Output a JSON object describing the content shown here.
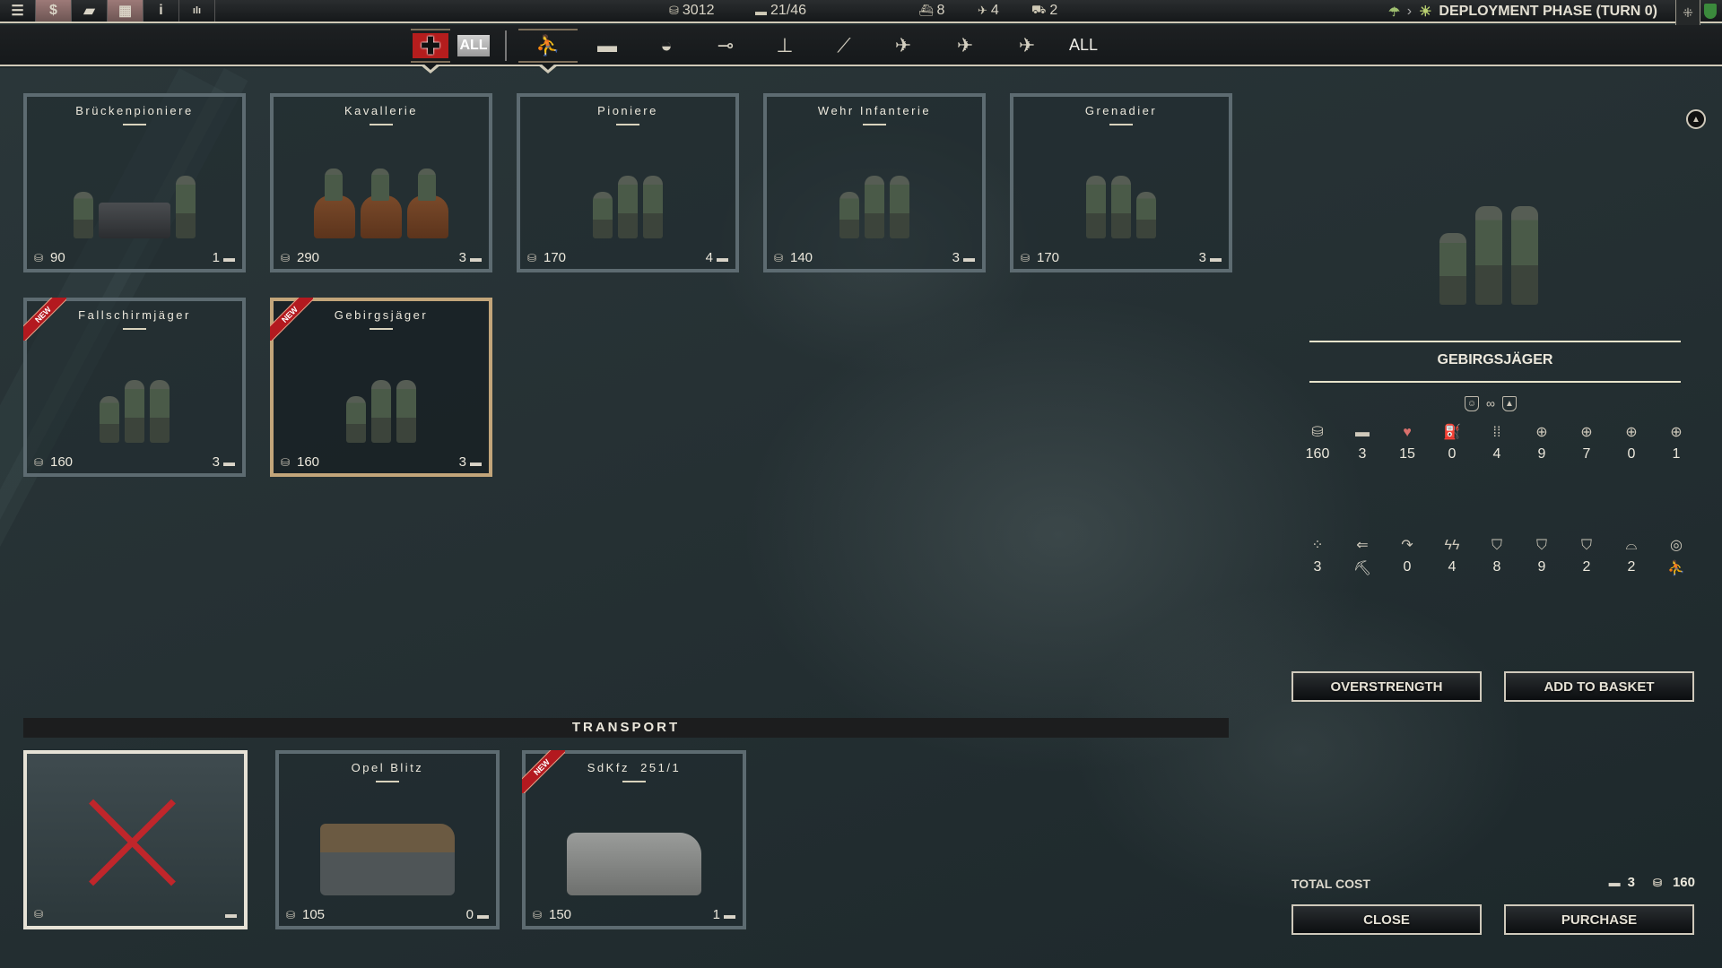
{
  "topbar": {
    "buttons": [
      {
        "name": "menu-icon",
        "glyph": "☰"
      },
      {
        "name": "dollar-icon",
        "glyph": "$"
      },
      {
        "name": "chat-icon",
        "glyph": "▰"
      },
      {
        "name": "grid-icon",
        "glyph": "▦"
      },
      {
        "name": "info-icon",
        "glyph": "i"
      },
      {
        "name": "stats-icon",
        "glyph": "ılı"
      }
    ],
    "prestige": "3012",
    "core_slots": "21/46",
    "naval": "8",
    "air": "4",
    "rail": "2",
    "phase": "DEPLOYMENT PHASE (TURN 0)"
  },
  "filterbar": {
    "nation_all": "ALL",
    "categories": [
      {
        "name": "infantry",
        "glyph": "⛹"
      },
      {
        "name": "tank",
        "glyph": "▬"
      },
      {
        "name": "recon",
        "glyph": "◒"
      },
      {
        "name": "anti-tank",
        "glyph": "⊸"
      },
      {
        "name": "anti-air",
        "glyph": "⊥"
      },
      {
        "name": "artillery",
        "glyph": "⟋"
      },
      {
        "name": "fighter",
        "glyph": "✈"
      },
      {
        "name": "tactical-bomber",
        "glyph": "✈"
      },
      {
        "name": "strategic-bomber",
        "glyph": "✈"
      }
    ],
    "all_label": "ALL"
  },
  "units": [
    {
      "name": "Brückenpioniere",
      "cost": "90",
      "slots": "1",
      "new": false,
      "selected": false
    },
    {
      "name": "Kavallerie",
      "cost": "290",
      "slots": "3",
      "new": false,
      "selected": false
    },
    {
      "name": "Pioniere",
      "cost": "170",
      "slots": "4",
      "new": false,
      "selected": false
    },
    {
      "name": "Wehr Infanterie",
      "cost": "140",
      "slots": "3",
      "new": false,
      "selected": false
    },
    {
      "name": "Grenadier",
      "cost": "170",
      "slots": "3",
      "new": false,
      "selected": false
    },
    {
      "name": "Fallschirmjäger",
      "cost": "160",
      "slots": "3",
      "new": true,
      "selected": false
    },
    {
      "name": "Gebirgsjäger",
      "cost": "160",
      "slots": "3",
      "new": true,
      "selected": true
    }
  ],
  "new_badge": "NEW",
  "transport": {
    "title": "TRANSPORT",
    "items": [
      {
        "name": "",
        "cost": "",
        "slots": "",
        "none": true
      },
      {
        "name": "Opel Blitz",
        "cost": "105",
        "slots": "0",
        "new": false
      },
      {
        "name": "SdKfz  251/1",
        "cost": "150",
        "slots": "1",
        "new": true
      }
    ]
  },
  "detail": {
    "unit_name": "GEBIRGSJÄGER",
    "stats_row1": [
      {
        "icon": "cost-icon",
        "glyph": "⛁",
        "value": "160"
      },
      {
        "icon": "slots-icon",
        "glyph": "▬",
        "value": "3"
      },
      {
        "icon": "health-icon",
        "glyph": "♥",
        "value": "15"
      },
      {
        "icon": "fuel-icon",
        "glyph": "⛽",
        "value": "0"
      },
      {
        "icon": "ammo-icon",
        "glyph": "⁞⁞",
        "value": "4"
      },
      {
        "icon": "soft-attack-icon",
        "glyph": "⊕",
        "value": "9"
      },
      {
        "icon": "hard-attack-icon",
        "glyph": "⊕",
        "value": "7"
      },
      {
        "icon": "air-attack-icon",
        "glyph": "⊕",
        "value": "0"
      },
      {
        "icon": "naval-attack-icon",
        "glyph": "⊕",
        "value": "1"
      }
    ],
    "stats_row2": [
      {
        "icon": "movement-icon",
        "glyph": "⁘",
        "value": "3"
      },
      {
        "icon": "movement-type-icon",
        "glyph": "⇐",
        "value": "⛏"
      },
      {
        "icon": "spotting-icon",
        "glyph": "↷",
        "value": "0"
      },
      {
        "icon": "initiative-icon",
        "glyph": "ϟϟ",
        "value": "4"
      },
      {
        "icon": "ground-defense-icon",
        "glyph": "⛉",
        "value": "8"
      },
      {
        "icon": "air-defense-icon",
        "glyph": "⛉",
        "value": "9"
      },
      {
        "icon": "close-defense-icon",
        "glyph": "⛉",
        "value": "2"
      },
      {
        "icon": "vision-icon",
        "glyph": "⌓",
        "value": "2"
      },
      {
        "icon": "target-type-icon",
        "glyph": "◎",
        "value": "⛹"
      }
    ],
    "overstrength_label": "OVERSTRENGTH",
    "add_to_basket_label": "ADD TO BASKET",
    "total_cost_label": "TOTAL COST",
    "total_slots": "3",
    "total_prestige": "160",
    "close_label": "CLOSE",
    "purchase_label": "PURCHASE"
  }
}
